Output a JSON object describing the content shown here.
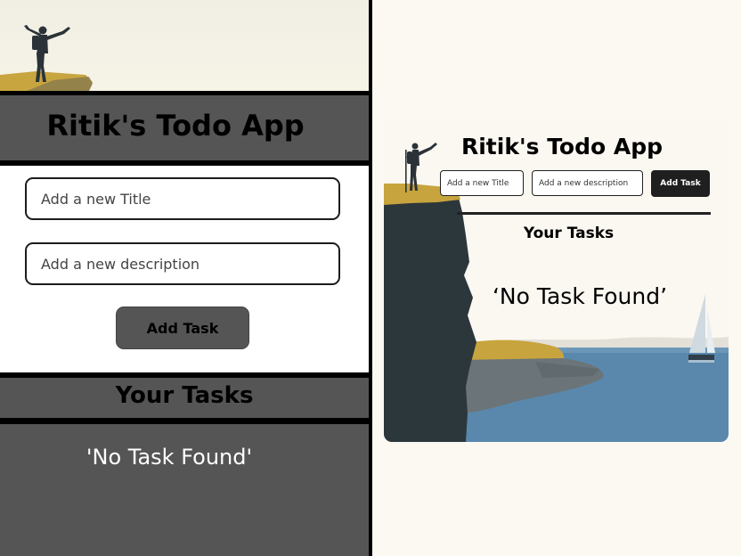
{
  "app": {
    "title": "Ritik's Todo App"
  },
  "form": {
    "title_placeholder": "Add a new Title",
    "description_placeholder": "Add a new description",
    "add_button_label": "Add Task"
  },
  "tasks": {
    "heading": "Your Tasks",
    "empty_message": "'No Task Found'",
    "empty_message_desktop": "‘No Task Found’"
  },
  "colors": {
    "panel_gray": "#555555",
    "button_dark": "#1f1f1f",
    "page_cream": "#fcf9f3",
    "sea_blue": "#5a88ad",
    "cliff_dark": "#2c373c",
    "grass_mustard": "#c7a43d"
  },
  "icons": [
    "hiker-silhouette-illustration",
    "sailboat-illustration",
    "cliff-illustration"
  ]
}
